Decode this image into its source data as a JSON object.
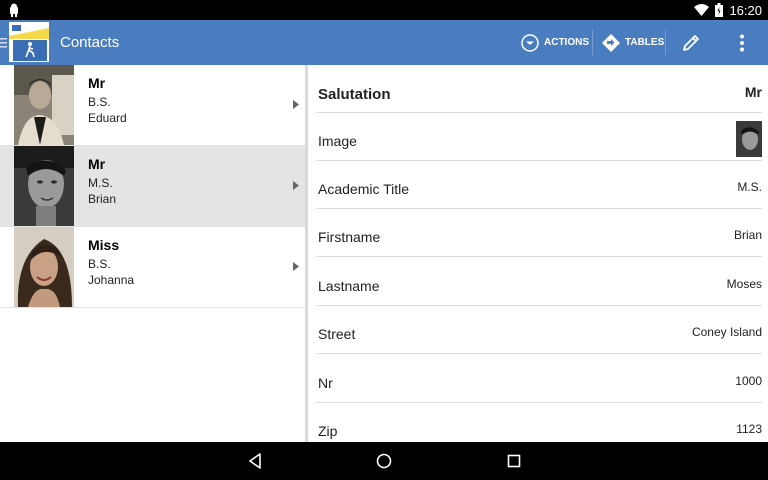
{
  "status_bar": {
    "time": "16:20"
  },
  "app_bar": {
    "title": "Contacts",
    "actions_label": "ACTIONS",
    "tables_label": "TABLES"
  },
  "contacts": [
    {
      "salutation": "Mr",
      "title": "B.S.",
      "firstname": "Eduard",
      "selected": false
    },
    {
      "salutation": "Mr",
      "title": "M.S.",
      "firstname": "Brian",
      "selected": true
    },
    {
      "salutation": "Miss",
      "title": "B.S.",
      "firstname": "Johanna",
      "selected": false
    }
  ],
  "details": {
    "salutation": {
      "label": "Salutation",
      "value": "Mr"
    },
    "image": {
      "label": "Image"
    },
    "academic_title": {
      "label": "Academic Title",
      "value": "M.S."
    },
    "firstname": {
      "label": "Firstname",
      "value": "Brian"
    },
    "lastname": {
      "label": "Lastname",
      "value": "Moses"
    },
    "street": {
      "label": "Street",
      "value": "Coney Island"
    },
    "nr": {
      "label": "Nr",
      "value": "1000"
    },
    "zip": {
      "label": "Zip",
      "value": "1123"
    }
  },
  "colors": {
    "app_bar": "#4a7dc0",
    "selected_row": "#e4e4e4"
  }
}
